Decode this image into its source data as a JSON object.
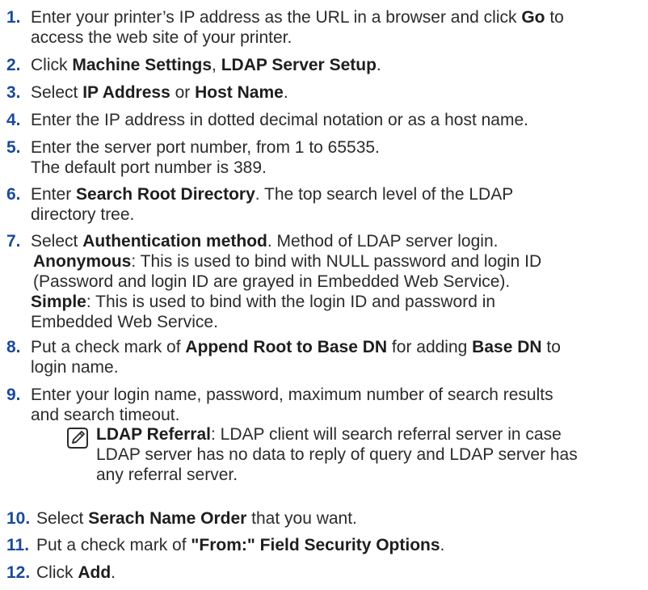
{
  "steps": [
    {
      "num": "1.",
      "a": "Enter your printer’s IP address as the URL in a browser and click ",
      "b1": "Go",
      "c": " to",
      "line2": "access the web site of your printer."
    },
    {
      "num": "2.",
      "a": "Click ",
      "b1": "Machine Settings",
      "c": ", ",
      "b2": "LDAP Server Setup",
      "d": "."
    },
    {
      "num": "3.",
      "a": "Select ",
      "b1": "IP Address",
      "c": " or ",
      "b2": "Host Name",
      "d": "."
    },
    {
      "num": "4.",
      "a": "Enter the IP address in dotted decimal notation or as a host name."
    },
    {
      "num": "5.",
      "a": "Enter the server port number, from 1 to 65535.",
      "line2": "The default port number is 389."
    },
    {
      "num": "6.",
      "a": "Enter ",
      "b1": "Search Root Directory",
      "c": ". The top search level of the LDAP",
      "line2": "directory tree."
    },
    {
      "num": "7.",
      "a": "Select ",
      "b1": "Authentication method",
      "c": ". Method of LDAP server login.",
      "anon_label": "Anonymous",
      "anon_text": ": This is used to bind with NULL password and login ID",
      "anon_line2": "(Password and login ID are grayed in Embedded Web Service).",
      "simple_label": "Simple",
      "simple_text": ": This is used to bind with the login ID and password in",
      "simple_line2": "Embedded Web Service."
    },
    {
      "num": "8.",
      "a": "Put a check mark of ",
      "b1": "Append Root to Base DN",
      "c": " for adding ",
      "b2": "Base DN",
      "d": " to",
      "line2": "login name."
    },
    {
      "num": "9.",
      "a": "Enter your login name, password, maximum number of search results",
      "line2": "and search timeout."
    },
    {
      "num": "10.",
      "a": "Select ",
      "b1": "Serach Name Order",
      "c": " that you want."
    },
    {
      "num": "11.",
      "a": "Put a check mark of ",
      "b1": "\"From:\" Field Security Options",
      "c": "."
    },
    {
      "num": "12.",
      "a": "Click ",
      "b1": "Add",
      "c": "."
    }
  ],
  "note": {
    "icon": "note-pencil-icon",
    "label": "LDAP Referral",
    "line1": ": LDAP client will search referral server in case",
    "line2": "LDAP server has no data to reply of query and LDAP server has",
    "line3": "any referral server."
  },
  "colors": {
    "number": "#1a4a9c",
    "text": "#2b2b2b"
  }
}
